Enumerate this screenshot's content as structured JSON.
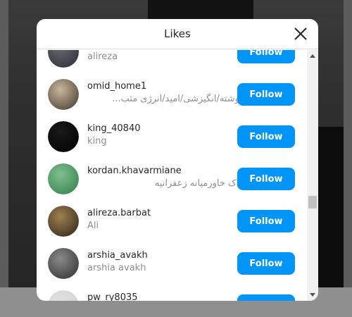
{
  "modal": {
    "title": "Likes",
    "close_icon": "close-icon"
  },
  "users": [
    {
      "username": "",
      "fullname": "alireza",
      "follow_label": "Follow",
      "rtl": false,
      "avatar_colors": [
        "#666a70",
        "#2a2d33"
      ]
    },
    {
      "username": "omid_home1",
      "fullname": "دلنوشته/انگیزشی/امید/انرژی مثب...",
      "follow_label": "Follow",
      "rtl": true,
      "avatar_colors": [
        "#c8b79c",
        "#3e3429"
      ]
    },
    {
      "username": "king_40840",
      "fullname": "king",
      "follow_label": "Follow",
      "rtl": false,
      "avatar_colors": [
        "#1a1a1a",
        "#000000"
      ]
    },
    {
      "username": "kordan.khavarmiane",
      "fullname": "املاک خاورمیانه زعفرانیه",
      "follow_label": "Follow",
      "rtl": true,
      "avatar_colors": [
        "#7fbf8e",
        "#2f7d4a"
      ]
    },
    {
      "username": "alireza.barbat",
      "fullname": "Ali",
      "follow_label": "Follow",
      "rtl": false,
      "avatar_colors": [
        "#a08050",
        "#2a2218"
      ]
    },
    {
      "username": "arshia_avakh",
      "fullname": "arshia avakh",
      "follow_label": "Follow",
      "rtl": false,
      "avatar_colors": [
        "#8a8a8a",
        "#2c2c2c"
      ]
    },
    {
      "username": "pw_ry8035",
      "fullname": "",
      "follow_label": "Follow",
      "rtl": false,
      "avatar_colors": [
        "#e0e0e0",
        "#d0d0d0"
      ]
    }
  ],
  "colors": {
    "follow_button": "#0095f6",
    "username_text": "#262626",
    "secondary_text": "#8e8e8e"
  }
}
